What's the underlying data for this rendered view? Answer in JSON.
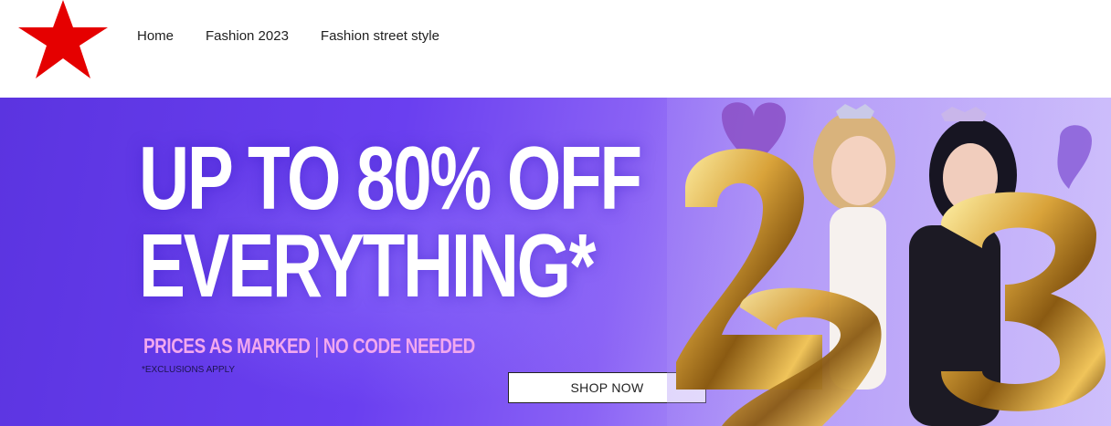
{
  "nav": {
    "items": [
      {
        "label": "Home"
      },
      {
        "label": "Fashion 2023"
      },
      {
        "label": "Fashion street style"
      }
    ]
  },
  "logo": {
    "icon": "red-star-icon",
    "color": "#e50000"
  },
  "banner": {
    "headline_line1": "UP TO 80% OFF",
    "headline_line2": "EVERYTHING*",
    "sub_left": "PRICES AS MARKED",
    "sub_sep": "|",
    "sub_right": "NO CODE NEEDED",
    "exclusions": "*EXCLUSIONS APPLY",
    "cta_label": "SHOP NOW",
    "photo_icon": "party-girls-balloons-photo",
    "colors": {
      "background": "#6a3ff0",
      "subtext": "#f2a8ef",
      "headline": "#ffffff"
    }
  }
}
